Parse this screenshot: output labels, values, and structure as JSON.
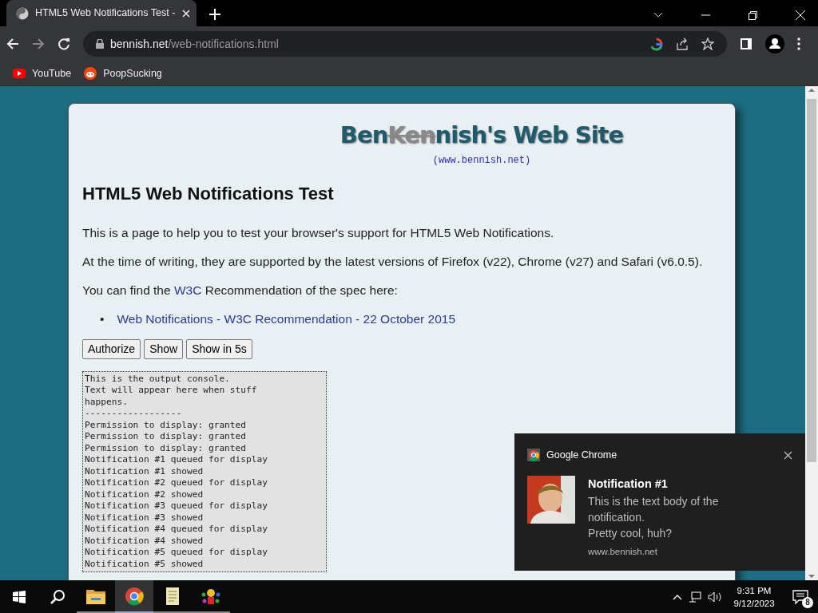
{
  "browser": {
    "tabs": [
      {
        "title": "HTML5 Web Notifications Test - ",
        "selected": true
      }
    ],
    "address": {
      "domain": "bennish.net",
      "path": "/web-notifications.html"
    },
    "bookmarks": [
      {
        "label": "YouTube",
        "kind": "youtube"
      },
      {
        "label": "PoopSucking",
        "kind": "reddit"
      }
    ]
  },
  "page": {
    "site_title": [
      {
        "text": "Ben",
        "struck": false
      },
      {
        "text": "Ken",
        "struck": true
      },
      {
        "text": "nish's Web Site",
        "struck": false
      }
    ],
    "site_url": "(www.bennish.net)",
    "heading": "HTML5 Web Notifications Test",
    "paragraphs": [
      [
        {
          "kind": "text",
          "text": "This is a page to help you to test your browser's support for HTML5 Web Notifications."
        }
      ],
      [
        {
          "kind": "text",
          "text": "At the time of writing, they are supported by the latest versions of Firefox (v22), Chrome (v27) and Safari (v6.0.5)."
        }
      ],
      [
        {
          "kind": "text",
          "text": "You can find the "
        },
        {
          "kind": "link",
          "text": "W3C"
        },
        {
          "kind": "text",
          "text": " Recommendation of the spec here:"
        }
      ]
    ],
    "links": [
      {
        "marker": "•",
        "text": "Web Notifications - W3C Recommendation - 22 October 2015"
      }
    ],
    "buttons": [
      "Authorize",
      "Show",
      "Show in 5s"
    ],
    "console": [
      "This is the output console.",
      "Text will appear here when stuff",
      "happens.",
      "------------------",
      "Permission to display: granted",
      "Permission to display: granted",
      "Permission to display: granted",
      "Notification #1 queued for display",
      "Notification #1 showed",
      "Notification #2 queued for display",
      "Notification #2 showed",
      "Notification #3 queued for display",
      "Notification #3 showed",
      "Notification #4 queued for display",
      "Notification #4 showed",
      "Notification #5 queued for display",
      "Notification #5 showed"
    ]
  },
  "notification": {
    "app": "Google Chrome",
    "title": "Notification #1",
    "body": [
      "This is the text body of the notification.",
      "Pretty cool, huh?"
    ],
    "source": "www.bennish.net"
  },
  "taskbar": {
    "apps": [
      {
        "kind": "folder",
        "running": true,
        "selected": false
      },
      {
        "kind": "chrome",
        "running": true,
        "selected": true
      },
      {
        "kind": "notepad",
        "running": true,
        "selected": false
      },
      {
        "kind": "game",
        "running": true,
        "selected": false
      }
    ],
    "time": "9:31 PM",
    "date": "9/12/2023",
    "notification_count": "8"
  }
}
